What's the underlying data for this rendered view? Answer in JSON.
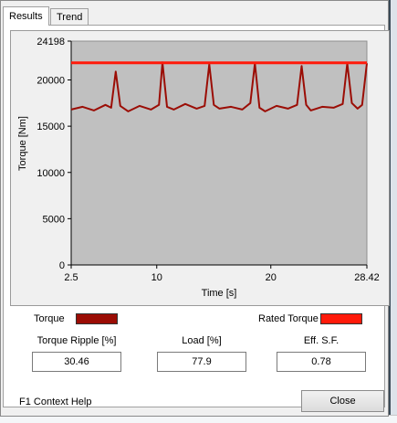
{
  "tabs": [
    "Results",
    "Trend"
  ],
  "chart_data": {
    "type": "line",
    "xlabel": "Time [s]",
    "ylabel": "Torque [Nm]",
    "xlim": [
      2.5,
      28.42
    ],
    "ylim": [
      0,
      24198
    ],
    "x_ticks": [
      "2.5",
      "10",
      "20",
      "28.42"
    ],
    "y_ticks": [
      "0",
      "5000",
      "10000",
      "15000",
      "20000",
      "24198"
    ],
    "series": [
      {
        "name": "Torque",
        "color": "#9b0d05",
        "x": [
          2.5,
          3.5,
          4.5,
          5.5,
          6.0,
          6.4,
          6.8,
          7.5,
          8.5,
          9.5,
          10.2,
          10.5,
          10.9,
          11.5,
          12.5,
          13.5,
          14.2,
          14.6,
          15.0,
          15.5,
          16.5,
          17.5,
          18.2,
          18.6,
          19.0,
          19.5,
          20.5,
          21.5,
          22.3,
          22.7,
          23.1,
          23.5,
          24.5,
          25.5,
          26.3,
          26.7,
          27.1,
          27.6,
          28.0,
          28.42
        ],
        "y": [
          16800,
          17100,
          16700,
          17300,
          17000,
          20900,
          17200,
          16600,
          17200,
          16800,
          17300,
          21900,
          17100,
          16800,
          17400,
          16900,
          17200,
          21700,
          17300,
          16900,
          17100,
          16800,
          17500,
          21800,
          17000,
          16600,
          17200,
          16900,
          17300,
          21500,
          17300,
          16700,
          17100,
          17000,
          17400,
          21800,
          17500,
          16900,
          17300,
          21800
        ]
      },
      {
        "name": "Rated Torque",
        "color": "#ff1a0a",
        "x": [
          2.5,
          28.42
        ],
        "y": [
          21850,
          21850
        ]
      }
    ]
  },
  "legend": {
    "torque_label": "Torque",
    "torque_color": "#9b0d05",
    "rated_label": "Rated Torque",
    "rated_color": "#ff1a0a"
  },
  "metrics": [
    {
      "label": "Torque Ripple [%]",
      "value": "30.46"
    },
    {
      "label": "Load [%]",
      "value": "77.9"
    },
    {
      "label": "Eff. S.F.",
      "value": "0.78"
    }
  ],
  "footer": {
    "help_text": "F1 Context Help",
    "close_label": "Close"
  }
}
